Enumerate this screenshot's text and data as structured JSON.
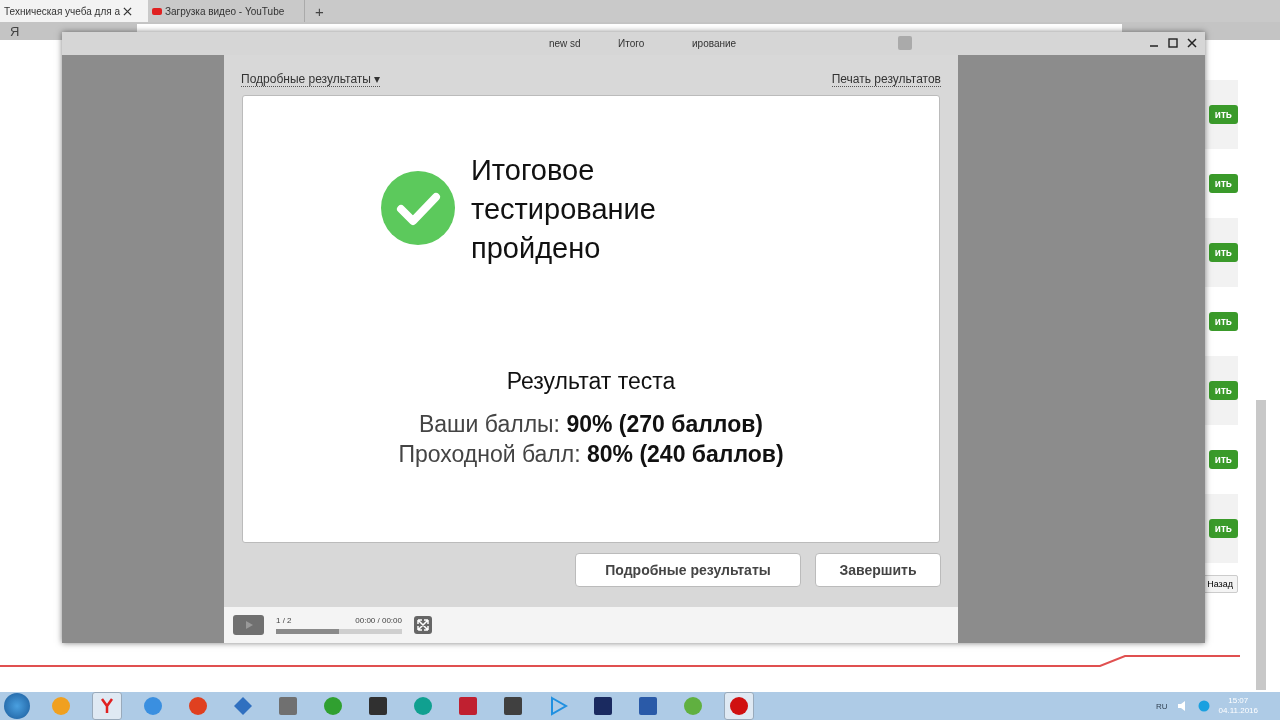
{
  "browser": {
    "tabs": [
      {
        "label": "Техническая учеба для а",
        "selected": true
      },
      {
        "label": "Загрузка видео - YouTube",
        "selected": false
      }
    ],
    "new_tab": "+",
    "yandex_button": "Я",
    "page": {
      "action_buttons": [
        "ить",
        "ить",
        "ить",
        "ить",
        "ить",
        "ить",
        "ить"
      ],
      "back_button": "Назад"
    }
  },
  "popup": {
    "title_fragments": [
      "new sd",
      "Итого",
      "ирование"
    ],
    "header": {
      "details_menu": "Подробные результаты",
      "menu_caret": "▾",
      "print_link": "Печать результатов"
    },
    "result": {
      "passed": true,
      "heading": "Итоговое тестирование пройдено",
      "section_title": "Результат теста",
      "lines": [
        {
          "label": "Ваши баллы:",
          "value": "90% (270 баллов)"
        },
        {
          "label": "Проходной балл:",
          "value": "80% (240 баллов)"
        }
      ]
    },
    "buttons": [
      {
        "label": "Подробные результаты",
        "kind": "secondary"
      },
      {
        "label": "Завершить",
        "kind": "primary"
      }
    ],
    "player": {
      "slide": "1 / 2",
      "time": "00:00 / 00:00",
      "level": 0.5
    }
  },
  "taskbar": {
    "apps": [
      {
        "kind": "ie",
        "selected": false
      },
      {
        "kind": "yandex",
        "selected": true
      },
      {
        "kind": "chrome",
        "selected": false
      },
      {
        "kind": "ccleaner",
        "selected": false
      },
      {
        "kind": "network",
        "selected": false
      },
      {
        "kind": "usb",
        "selected": false
      },
      {
        "kind": "wifi",
        "selected": false
      },
      {
        "kind": "ggame",
        "selected": false
      },
      {
        "kind": "eset",
        "selected": false
      },
      {
        "kind": "huawei",
        "selected": false
      },
      {
        "kind": "tank",
        "selected": false
      },
      {
        "kind": "play",
        "selected": false
      },
      {
        "kind": "ps",
        "selected": false
      },
      {
        "kind": "word",
        "selected": false
      },
      {
        "kind": "android",
        "selected": false
      },
      {
        "kind": "record",
        "selected": true
      }
    ],
    "language": "RU",
    "time": "15:07",
    "date": "04.11.2016"
  }
}
